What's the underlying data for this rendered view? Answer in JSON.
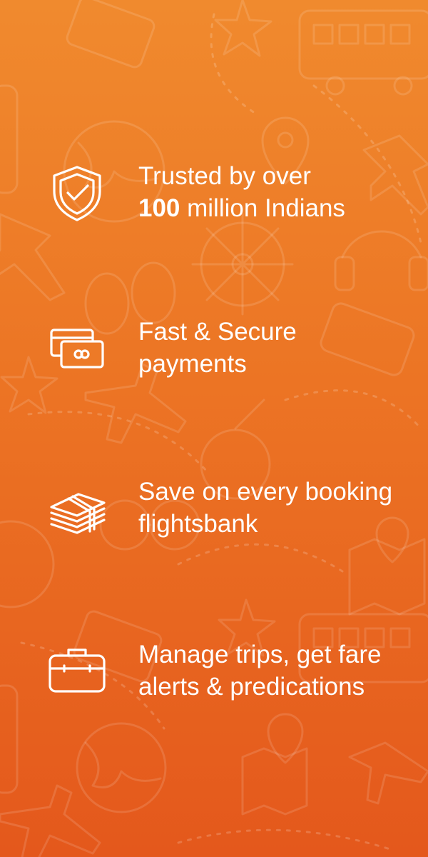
{
  "features": [
    {
      "icon": "shield-check-icon",
      "line1": "Trusted by over",
      "line2_bold": "100",
      "line2_rest": " million Indians"
    },
    {
      "icon": "cards-icon",
      "line1": "Fast & Secure",
      "line2": "payments"
    },
    {
      "icon": "money-stack-icon",
      "line1": "Save on every booking",
      "line2": "flightsbank"
    },
    {
      "icon": "briefcase-icon",
      "line1": "Manage trips, get fare",
      "line2": "alerts & predications"
    }
  ],
  "colors": {
    "gradient_top": "#f08a2e",
    "gradient_bottom": "#e4581c",
    "text": "#ffffff"
  }
}
